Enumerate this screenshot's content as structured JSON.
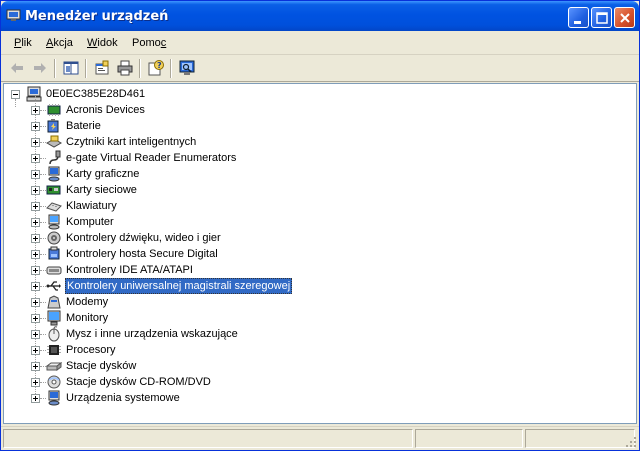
{
  "window": {
    "title": "Menedżer urządzeń",
    "accent": "#0053e1",
    "close_color": "#d9532c"
  },
  "menu": {
    "items": [
      {
        "label_hot": "P",
        "label_rest": "lik"
      },
      {
        "label_hot": "A",
        "label_rest": "kcja"
      },
      {
        "label_hot": "W",
        "label_rest": "idok"
      },
      {
        "label_pre": "Pomo",
        "label_hot": "c"
      }
    ]
  },
  "toolbar": {
    "buttons": [
      "back-arrow-icon",
      "forward-arrow-icon",
      "show-hide-console-tree-icon",
      "properties-icon",
      "print-icon",
      "help-icon",
      "scan-hardware-icon"
    ]
  },
  "tree": {
    "root": "0E0EC385E28D461",
    "selected_index": 11,
    "items": [
      {
        "label": "Acronis Devices",
        "icon": "chip-icon"
      },
      {
        "label": "Baterie",
        "icon": "battery-icon"
      },
      {
        "label": "Czytniki kart inteligentnych",
        "icon": "smartcard-reader-icon"
      },
      {
        "label": "e-gate Virtual Reader Enumerators",
        "icon": "plug-icon"
      },
      {
        "label": "Karty graficzne",
        "icon": "display-adapter-icon"
      },
      {
        "label": "Karty sieciowe",
        "icon": "network-card-icon"
      },
      {
        "label": "Klawiatury",
        "icon": "keyboard-icon"
      },
      {
        "label": "Komputer",
        "icon": "computer-icon"
      },
      {
        "label": "Kontrolery dźwięku, wideo i gier",
        "icon": "speaker-icon"
      },
      {
        "label": "Kontrolery hosta Secure Digital",
        "icon": "sd-host-icon"
      },
      {
        "label": "Kontrolery IDE ATA/ATAPI",
        "icon": "ide-controller-icon"
      },
      {
        "label": "Kontrolery uniwersalnej magistrali szeregowej",
        "icon": "usb-icon"
      },
      {
        "label": "Modemy",
        "icon": "modem-icon"
      },
      {
        "label": "Monitory",
        "icon": "monitor-icon"
      },
      {
        "label": "Mysz i inne urządzenia wskazujące",
        "icon": "mouse-icon"
      },
      {
        "label": "Procesory",
        "icon": "processor-icon"
      },
      {
        "label": "Stacje dysków",
        "icon": "disk-drive-icon"
      },
      {
        "label": "Stacje dysków CD-ROM/DVD",
        "icon": "cdrom-icon"
      },
      {
        "label": "Urządzenia systemowe",
        "icon": "system-device-icon"
      }
    ]
  },
  "status": {
    "pane1": "",
    "pane2": ""
  }
}
